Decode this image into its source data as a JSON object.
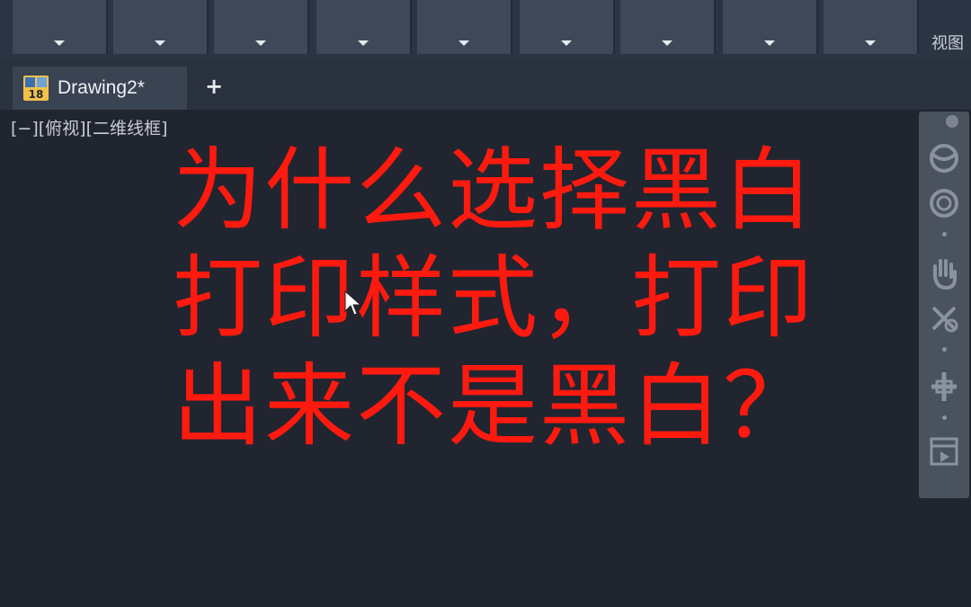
{
  "ribbon": {
    "buttons": [
      {
        "icon": "chevron-down-icon"
      },
      {
        "icon": "chevron-down-icon"
      },
      {
        "icon": "chevron-down-icon"
      },
      {
        "icon": "chevron-down-icon"
      },
      {
        "icon": "chevron-down-icon"
      },
      {
        "icon": "chevron-down-icon"
      },
      {
        "icon": "chevron-down-icon"
      },
      {
        "icon": "chevron-down-icon"
      },
      {
        "icon": "chevron-down-icon"
      }
    ],
    "panel_label": "视图"
  },
  "tabs": {
    "document_tab": {
      "title": "Drawing2*",
      "icon_number": "18"
    },
    "new_tab_symbol": "+"
  },
  "viewport": {
    "label": "[−][俯视][二维线框]"
  },
  "overlay_text": {
    "line1": "为什么选择黑白",
    "line2": "打印样式，打印",
    "line3": "出来不是黑白？"
  },
  "navbar": {
    "tools": [
      "steering-wheel-icon",
      "orbit-icon",
      "pan-hand-icon",
      "zoom-icon",
      "orbit-move-icon",
      "showmotion-icon"
    ]
  },
  "colors": {
    "background": "#212530",
    "overlay_text": "#ff1a0f"
  }
}
